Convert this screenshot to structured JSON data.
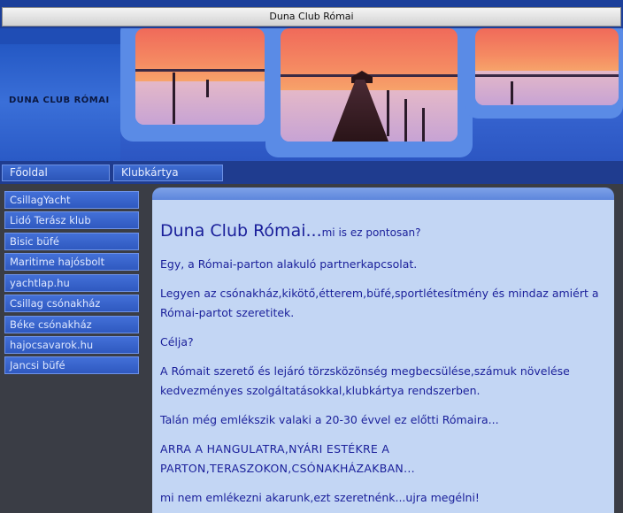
{
  "window": {
    "title": "Duna Club Római"
  },
  "header": {
    "site_name": "DUNA CLUB RÓMAI"
  },
  "nav": {
    "tabs": [
      "Főoldal",
      "Klubkártya"
    ]
  },
  "sidebar": {
    "items": [
      "CsillagYacht",
      "Lidó Terász klub",
      "Bisic büfé",
      "Maritime hajósbolt",
      "yachtlap.hu",
      "Csillag csónakház",
      "Béke csónakház",
      "hajocsavarok.hu",
      "Jancsi büfé"
    ]
  },
  "content": {
    "heading_main": "Duna Club Római...",
    "heading_small": "mi is ez pontosan?",
    "paragraphs": [
      "Egy, a Római-parton alakuló partnerkapcsolat.",
      "Legyen az csónakház,kikötő,étterem,büfé,sportlétesítmény és mindaz amiért a Római-partot szeretitek.",
      "Célja?",
      "A Rómait szerető és lejáró törzsközönség megbecsülése,számuk növelése kedvezményes szolgáltatásokkal,klubkártya rendszerben.",
      "Talán még emlékszik valaki a 20-30 évvel ez előtti Rómaira...",
      "ARRA A HANGULATRA,NYÁRI ESTÉKRE A PARTON,TERASZOKON,CSÓNAKHÁZAKBAN...",
      "mi nem emlékezni akarunk,ezt szeretnénk...ujra megélni!"
    ]
  }
}
